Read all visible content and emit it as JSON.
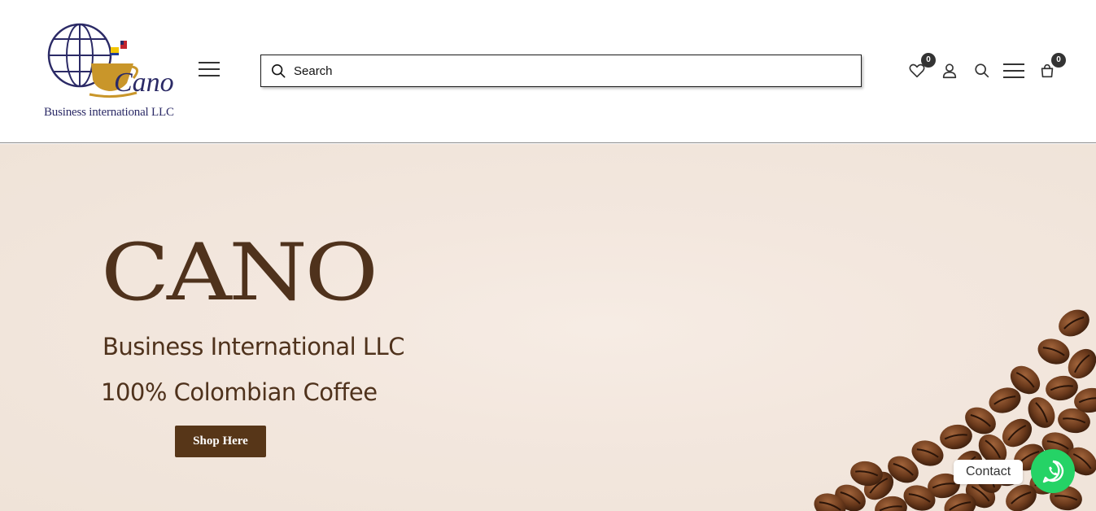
{
  "header": {
    "logo": {
      "brand_script": "Cano",
      "tagline": "Business international LLC"
    },
    "search": {
      "placeholder": "Search"
    },
    "icons": {
      "wishlist": {
        "icon": "heart-icon",
        "count": "0"
      },
      "account": {
        "icon": "user-icon"
      },
      "search": {
        "icon": "search-icon"
      },
      "menu": {
        "icon": "hamburger-icon"
      },
      "cart": {
        "icon": "bag-icon",
        "count": "0"
      }
    }
  },
  "hero": {
    "title": "CANO",
    "subtitle": "Business International LLC",
    "tagline": "100% Colombian Coffee",
    "cta_label": "Shop Here"
  },
  "floating": {
    "contact_label": "Contact",
    "whatsapp_icon": "whatsapp-icon"
  },
  "colors": {
    "brand_brown": "#573618",
    "text_brown": "#4f321c",
    "logo_navy": "#2b2a66",
    "logo_gold": "#c9962a",
    "whatsapp_green": "#25d366"
  }
}
